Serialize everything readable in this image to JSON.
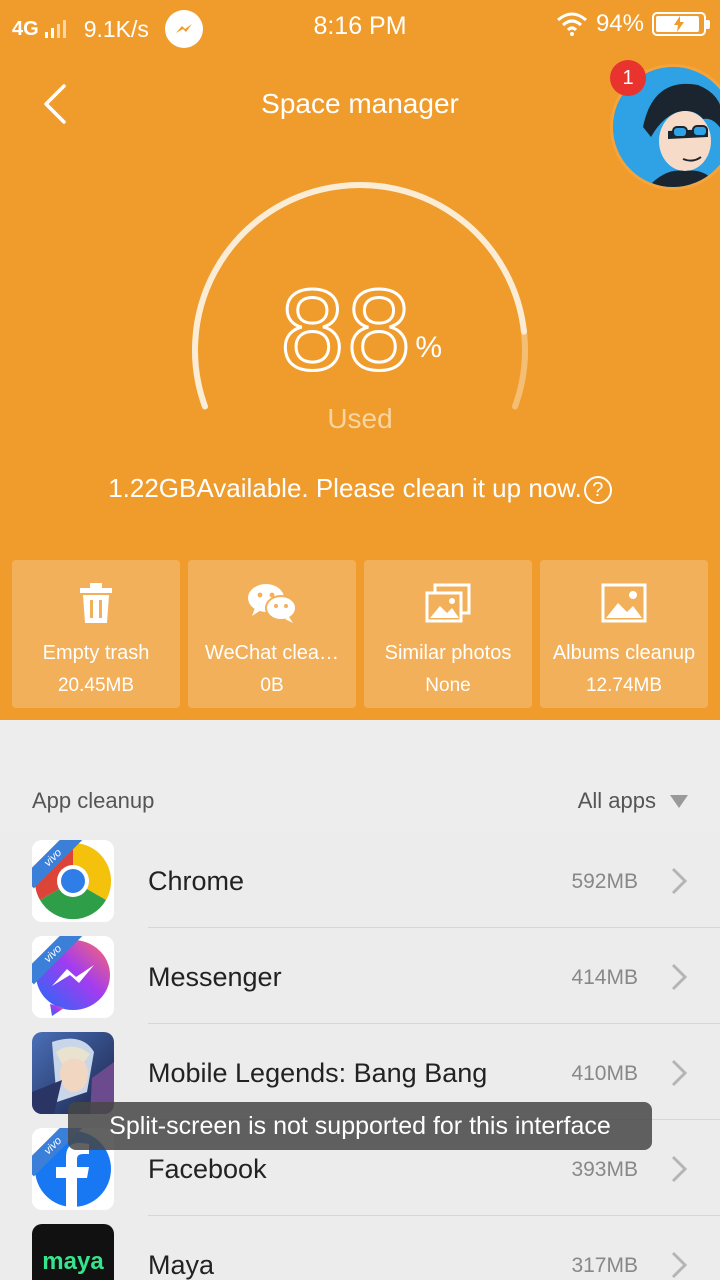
{
  "status_bar": {
    "network": "4G",
    "speed": "9.1K/s",
    "time": "8:16 PM",
    "battery": "94%",
    "battery_level": 0.94
  },
  "header": {
    "title": "Space manager",
    "avatar_badge": "1"
  },
  "gauge": {
    "percent": "88",
    "percent_symbol": "%",
    "percent_value": 88,
    "used_label": "Used",
    "available_text": "1.22GBAvailable. Please clean it up now.",
    "help_symbol": "?"
  },
  "cards": [
    {
      "label": "Empty trash",
      "value": "20.45MB",
      "icon": "trash-icon"
    },
    {
      "label": "WeChat clea…",
      "value": "0B",
      "icon": "wechat-icon"
    },
    {
      "label": "Similar photos",
      "value": "None",
      "icon": "similar-photos-icon"
    },
    {
      "label": "Albums cleanup",
      "value": "12.74MB",
      "icon": "album-icon"
    }
  ],
  "app_cleanup": {
    "title": "App cleanup",
    "filter": "All apps",
    "apps": [
      {
        "name": "Chrome",
        "size": "592MB",
        "icon": "chrome-icon"
      },
      {
        "name": "Messenger",
        "size": "414MB",
        "icon": "messenger-icon"
      },
      {
        "name": "Mobile Legends: Bang Bang",
        "size": "410MB",
        "icon": "mobile-legends-icon"
      },
      {
        "name": "Facebook",
        "size": "393MB",
        "icon": "facebook-icon"
      },
      {
        "name": "Maya",
        "size": "317MB",
        "icon": "maya-icon",
        "icon_text": "maya"
      }
    ]
  },
  "toast": {
    "text": "Split-screen is not supported for this interface"
  },
  "colors": {
    "header_bg": "#f09c2c",
    "card_bg": "#f3b05a",
    "list_bg": "#ececec",
    "badge": "#e8332f"
  }
}
